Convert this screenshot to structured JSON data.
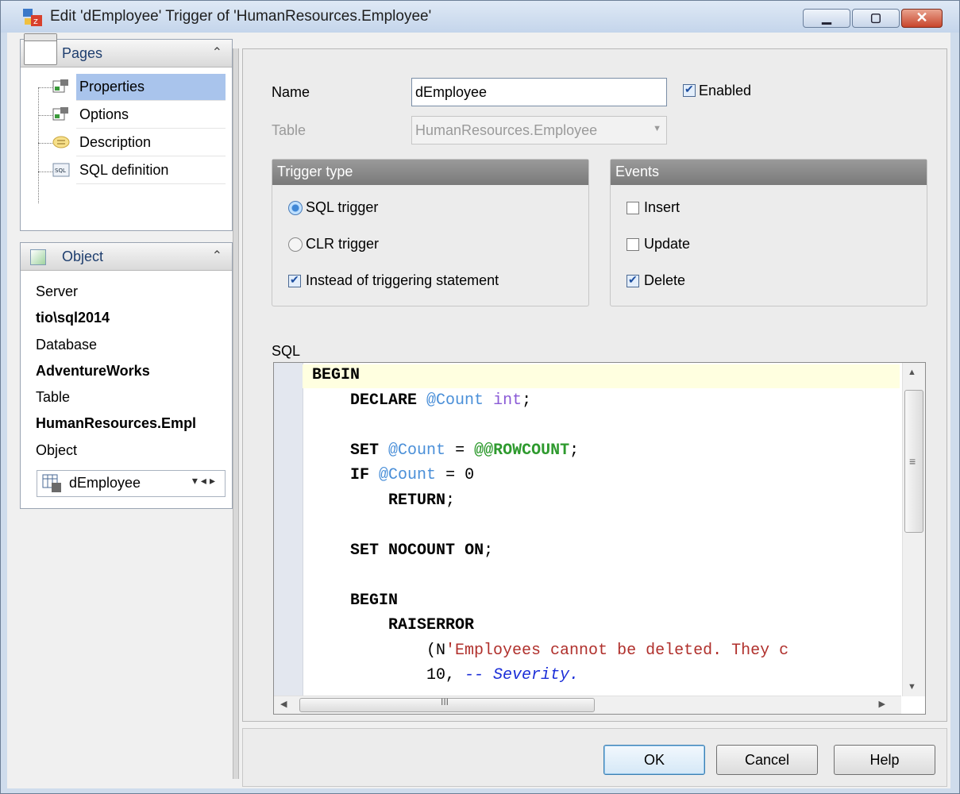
{
  "window": {
    "title": "Edit 'dEmployee' Trigger of 'HumanResources.Employee'"
  },
  "pages_pane": {
    "title": "Pages",
    "items": [
      {
        "label": "Properties",
        "selected": true
      },
      {
        "label": "Options"
      },
      {
        "label": "Description"
      },
      {
        "label": "SQL definition"
      }
    ]
  },
  "object_pane": {
    "title": "Object",
    "server_label": "Server",
    "server_value": "tio\\sql2014",
    "database_label": "Database",
    "database_value": "AdventureWorks",
    "table_label": "Table",
    "table_value": "HumanResources.Empl",
    "object_label": "Object",
    "object_value": "dEmployee"
  },
  "form": {
    "name_label": "Name",
    "name_value": "dEmployee",
    "enabled_label": "Enabled",
    "enabled_checked": true,
    "table_label": "Table",
    "table_value": "HumanResources.Employee"
  },
  "trigger_type": {
    "title": "Trigger type",
    "sql_trigger": "SQL trigger",
    "clr_trigger": "CLR trigger",
    "instead_of": "Instead of triggering statement",
    "selected": "SQL trigger",
    "instead_of_checked": true
  },
  "events": {
    "title": "Events",
    "insert": "Insert",
    "update": "Update",
    "delete": "Delete",
    "insert_checked": false,
    "update_checked": false,
    "delete_checked": true
  },
  "sql": {
    "label": "SQL",
    "lines": [
      "BEGIN",
      "    DECLARE @Count int;",
      "",
      "    SET @Count = @@ROWCOUNT;",
      "    IF @Count = 0",
      "        RETURN;",
      "",
      "    SET NOCOUNT ON;",
      "",
      "    BEGIN",
      "        RAISERROR",
      "            (N'Employees cannot be deleted. They c",
      "            10, -- Severity."
    ]
  },
  "buttons": {
    "ok": "OK",
    "cancel": "Cancel",
    "help": "Help"
  },
  "colors": {
    "selection": "#a9c4ec",
    "keyword": "#000000",
    "variable": "#4a8fd8",
    "string": "#b0302c",
    "comment": "#1c2fd8",
    "system": "#2e9a2e"
  }
}
